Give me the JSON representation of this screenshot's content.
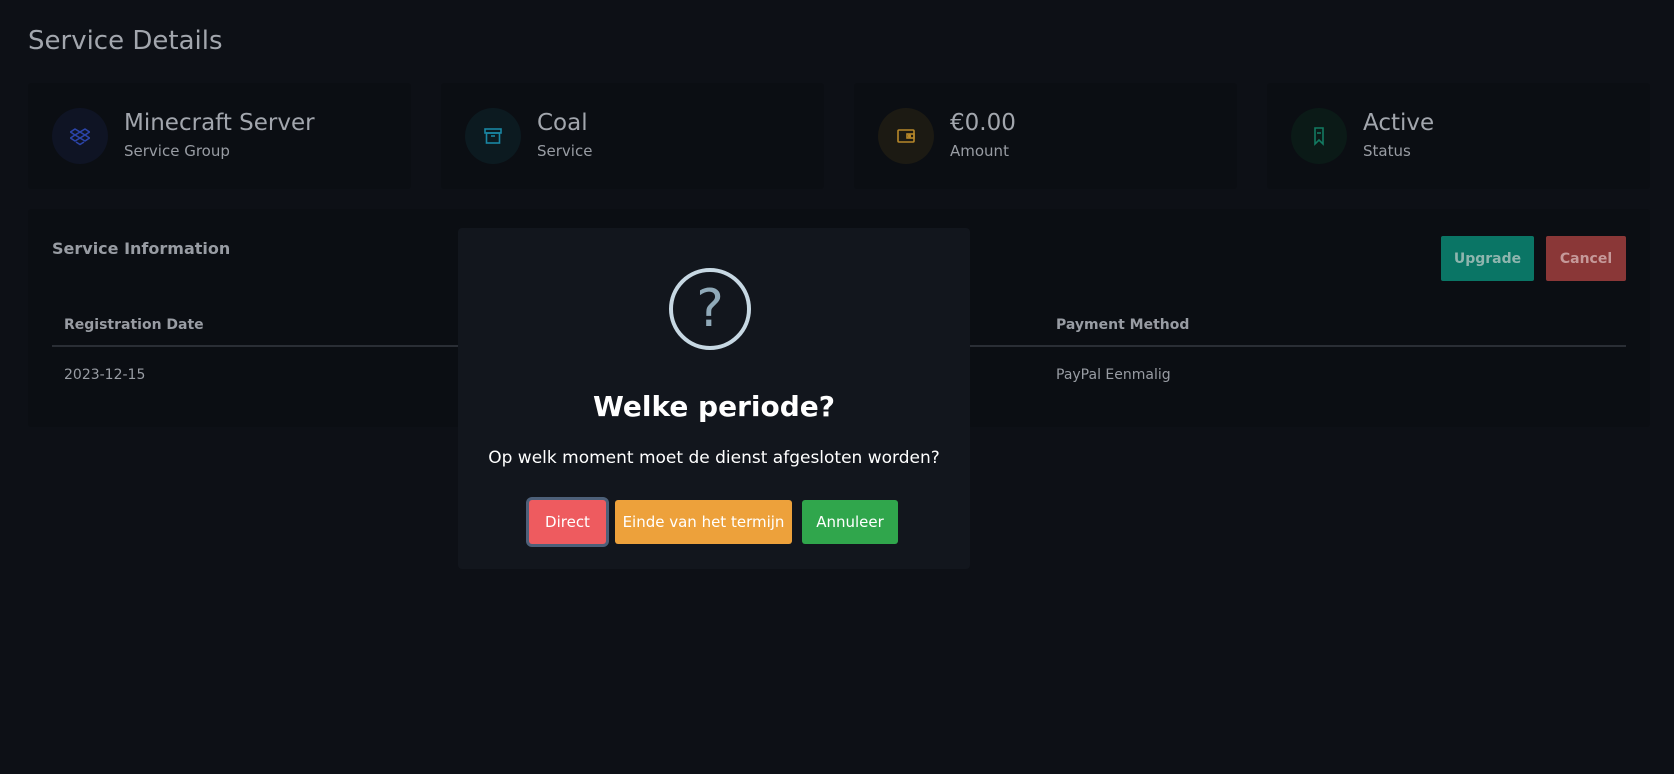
{
  "page": {
    "title": "Service Details"
  },
  "cards": [
    {
      "value": "Minecraft Server",
      "label": "Service Group",
      "icon": "dropbox-icon",
      "color": "#2b44a8"
    },
    {
      "value": "Coal",
      "label": "Service",
      "icon": "archive-icon",
      "color": "#1a86a3"
    },
    {
      "value": "€0.00",
      "label": "Amount",
      "icon": "wallet-icon",
      "color": "#b7882a"
    },
    {
      "value": "Active",
      "label": "Status",
      "icon": "bookmark-icon",
      "color": "#137a61"
    }
  ],
  "info": {
    "title": "Service Information",
    "upgrade_label": "Upgrade",
    "cancel_label": "Cancel",
    "columns": [
      "Registration Date",
      "Payment Method"
    ],
    "row": [
      "2023-12-15",
      "PayPal Eenmalig"
    ]
  },
  "modal": {
    "icon": "question-icon",
    "icon_glyph": "?",
    "title": "Welke periode?",
    "text": "Op welk moment moet de dienst afgesloten worden?",
    "buttons": {
      "direct": "Direct",
      "einde": "Einde van het termijn",
      "annuleer": "Annuleer"
    }
  },
  "colors": {
    "background": "#0d1016",
    "direct": "#ee5b5f",
    "einde": "#eda13b",
    "annuleer": "#30a64c",
    "upgrade": "#0a7565",
    "cancel": "#8a3737"
  }
}
